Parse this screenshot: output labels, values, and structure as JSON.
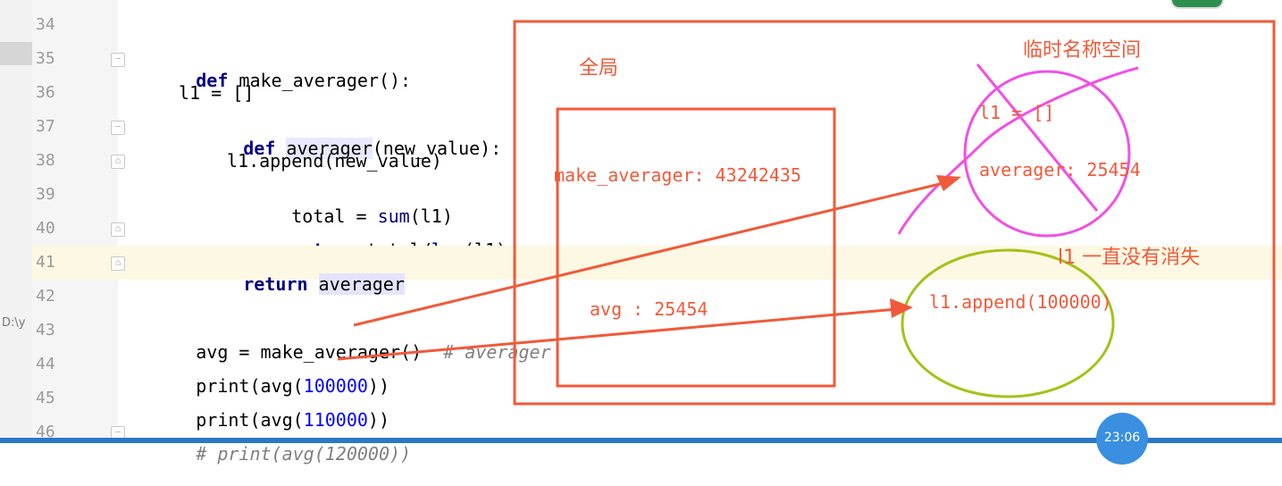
{
  "editor": {
    "side_path_label": "D:\\y",
    "lines": [
      {
        "num": "34"
      },
      {
        "num": "35",
        "tokens": {
          "kw": "def",
          "name": "make_averager",
          "rest": "():"
        }
      },
      {
        "num": "36",
        "text": "l1 = []"
      },
      {
        "num": "37",
        "tokens": {
          "kw": "def",
          "name": "averager",
          "rest": "(new_value):"
        }
      },
      {
        "num": "38",
        "text": "l1.append(new_value)"
      },
      {
        "num": "39",
        "tokens": {
          "a": "total = ",
          "bi": "sum",
          "b": "(l1)"
        }
      },
      {
        "num": "40",
        "tokens": {
          "kw": "return",
          "a": " total/",
          "bi": "len",
          "b": "(l1)"
        }
      },
      {
        "num": "41",
        "tokens": {
          "kw": "return",
          "ref": "averager"
        }
      },
      {
        "num": "42"
      },
      {
        "num": "43",
        "tokens": {
          "a": "avg = make_averager()",
          "cmt": "# averager"
        }
      },
      {
        "num": "44",
        "tokens": {
          "a": "print(avg(",
          "num": "100000",
          "b": "))"
        }
      },
      {
        "num": "45",
        "tokens": {
          "a": "print(avg(",
          "num": "110000",
          "b": "))"
        }
      },
      {
        "num": "46",
        "tokens": {
          "cmt": "# print(avg(120000))"
        }
      }
    ]
  },
  "annotations": {
    "global_label": "全局",
    "temp_namespace_label": "临时名称空间",
    "make_averager_entry": "make_averager: 43242435",
    "avg_entry": "avg : 25454",
    "l1_entry": "l1 = []",
    "averager_entry": "averager:  25454",
    "l1_persist_note": "l1 一直没有消失",
    "append_call": "l1.append(100000)"
  },
  "colors": {
    "annotation_red": "#f05a3a",
    "magenta": "#f050e6",
    "olive_green": "#a4c21a",
    "line_highlight": "#fcf8e4",
    "keyword": "#000080",
    "number": "#0000ff",
    "comment": "#808080"
  },
  "taskbar": {
    "clock": "23:06"
  }
}
